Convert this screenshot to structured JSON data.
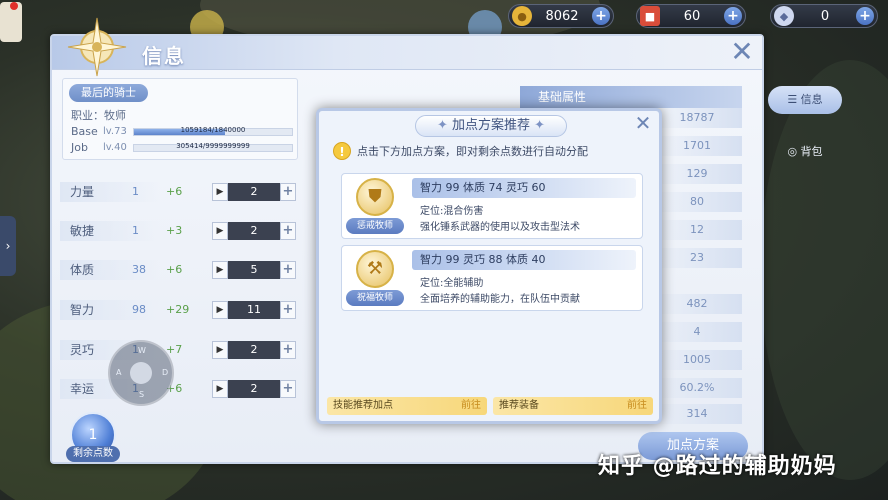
{
  "currency": [
    {
      "icon": "gold-coin-icon",
      "value": "8062",
      "color": "#e6b53a"
    },
    {
      "icon": "red-gem-icon",
      "value": "60",
      "color": "#d94d3a"
    },
    {
      "icon": "diamond-icon",
      "value": "0",
      "color": "#cfd8f0"
    }
  ],
  "panel": {
    "title": "信息"
  },
  "character": {
    "name": "最后的骑士",
    "job_label": "职业：牧师",
    "base_label": "Base",
    "base_level": "lv.73",
    "base_exp": "1059184/1840000",
    "base_progress": 0.576,
    "job_exp_label": "Job",
    "job_level": "lv.40",
    "job_exp": "305414/9999999999",
    "job_progress": 0.0
  },
  "stats": [
    {
      "label": "力量",
      "base": "1",
      "bonus": "+6",
      "value": "2"
    },
    {
      "label": "敏捷",
      "base": "1",
      "bonus": "+3",
      "value": "2"
    },
    {
      "label": "体质",
      "base": "38",
      "bonus": "+6",
      "value": "5"
    },
    {
      "label": "智力",
      "base": "98",
      "bonus": "+29",
      "value": "11"
    },
    {
      "label": "灵巧",
      "base": "1",
      "bonus": "+7",
      "value": "2"
    },
    {
      "label": "幸运",
      "base": "1",
      "bonus": "+6",
      "value": "2"
    }
  ],
  "remaining_points": {
    "value": "1",
    "label": "剩余点数"
  },
  "joystick": {
    "up": "W",
    "left": "A",
    "right": "D",
    "down": "S"
  },
  "attributes": {
    "header": "基础属性",
    "values": [
      "18787",
      "1701",
      "129",
      "80",
      "12",
      "23",
      "482",
      "4",
      "1005",
      "60.2%",
      "314"
    ]
  },
  "allocate_button": "加点方案",
  "side_tabs": [
    {
      "label": "信息",
      "icon": "list-icon",
      "active": true
    },
    {
      "label": "背包",
      "icon": "bag-icon",
      "active": false
    }
  ],
  "popup": {
    "title": "加点方案推荐",
    "hint": "点击下方加点方案，即对剩余点数进行自动分配",
    "plans": [
      {
        "icon": "shield-icon",
        "label": "惩戒牧师",
        "stats": "智力 99 体质 74 灵巧 60",
        "desc1": "定位:混合伤害",
        "desc2": "强化锤系武器的使用以及攻击型法术"
      },
      {
        "icon": "hammer-icon",
        "label": "祝福牧师",
        "stats": "智力 99 灵巧 88 体质 40",
        "desc1": "定位:全能辅助",
        "desc2": "全面培养的辅助能力，在队伍中贡献"
      }
    ],
    "recommend_skill": "技能推荐加点",
    "recommend_equip": "推荐装备",
    "go": "前往"
  },
  "watermark": "知乎 @路过的辅助奶妈"
}
